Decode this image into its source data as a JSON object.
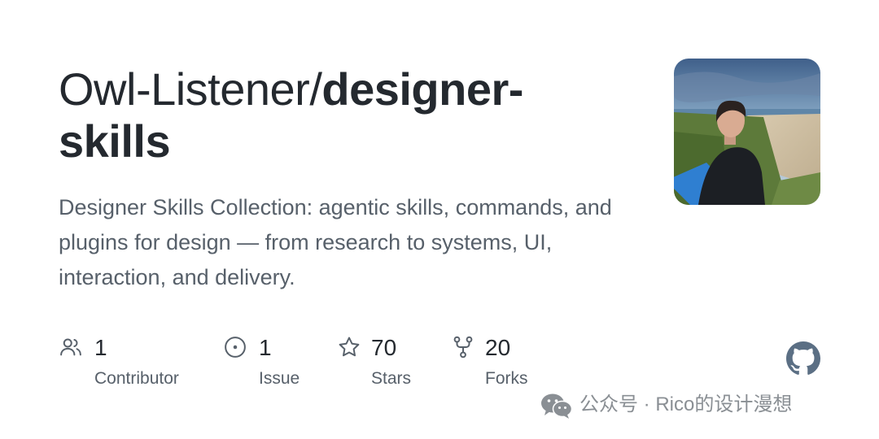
{
  "repo": {
    "owner": "Owl-Listener/",
    "name_line1": "designer-",
    "name_line2": "skills",
    "description": "Designer Skills Collection: agentic skills, commands, and plugins for design — from research to systems, UI, interaction, and delivery."
  },
  "stats": [
    {
      "icon": "people-icon",
      "value": "1",
      "label": "Contributor"
    },
    {
      "icon": "issue-icon",
      "value": "1",
      "label": "Issue"
    },
    {
      "icon": "star-icon",
      "value": "70",
      "label": "Stars"
    },
    {
      "icon": "fork-icon",
      "value": "20",
      "label": "Forks"
    }
  ],
  "watermark": {
    "text": "公众号 · Rico的设计漫想",
    "icon": "wechat-icon"
  },
  "colors": {
    "text": "#24292f",
    "muted": "#57606a",
    "icon": "#57606a",
    "github_logo": "#5b6f84"
  }
}
